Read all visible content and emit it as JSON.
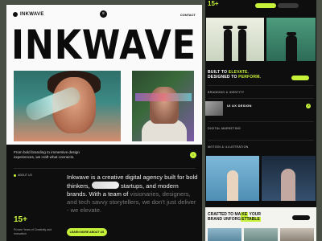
{
  "nav": {
    "brand": "INKWAVE",
    "menu_glyph": "≡",
    "contact": "CONTACT"
  },
  "hero": {
    "title": "INKWAVE"
  },
  "intro": {
    "text": "From bold branding to immersive design experiences, we craft what connects.",
    "arrow_glyph": "↓"
  },
  "about": {
    "label": "ABOUT US",
    "body_part1": "Inkwave is a creative digital agency built for bold thinkers,",
    "body_part2": "startups, and modern brands. With a team of",
    "body_muted1": "visionaries, designers, and tech savvy storytellers, we don’t just deliver - we elevate.",
    "stat_value": "15+",
    "stat_label": "Proven Years of Creativity and innovation",
    "cta": "LEARN MORE ABOUT US"
  },
  "right": {
    "stat_value": "15+",
    "headline_line1": "BUILT TO",
    "headline_hl1": "ELEVATE.",
    "headline_line2": "DESIGNED TO",
    "headline_hl2": "PERFORM.",
    "services": [
      "BRANDING & IDENTITY",
      "UI UX DESIGN",
      "DIGITAL MARKETING",
      "MOTION & ILLUSTRATION"
    ],
    "active_glyph": "↗",
    "bottom_line1": "CRAFTED TO MA",
    "bottom_hl1": "KE",
    "bottom_line1b": " YOUR",
    "bottom_line2": "BRAND UNFORG",
    "bottom_hl2": "ETTABLE"
  },
  "colors": {
    "accent": "#c7f23a",
    "background": "#4a4f46",
    "dark": "#0e0e0e",
    "light": "#fafafa"
  }
}
